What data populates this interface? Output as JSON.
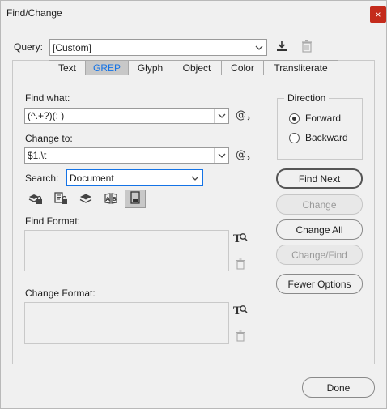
{
  "window": {
    "title": "Find/Change",
    "close_glyph": "×"
  },
  "query": {
    "label": "Query:",
    "value": "[Custom]"
  },
  "tabs": [
    {
      "label": "Text"
    },
    {
      "label": "GREP"
    },
    {
      "label": "Glyph"
    },
    {
      "label": "Object"
    },
    {
      "label": "Color"
    },
    {
      "label": "Transliterate"
    }
  ],
  "find_what": {
    "label": "Find what:",
    "value": "(^.+?)(: )"
  },
  "change_to": {
    "label": "Change to:",
    "value": "$1.\\t"
  },
  "search": {
    "label": "Search:",
    "value": "Document"
  },
  "find_format": {
    "label": "Find Format:"
  },
  "change_format": {
    "label": "Change Format:"
  },
  "direction": {
    "label": "Direction",
    "options": [
      {
        "label": "Forward",
        "selected": true
      },
      {
        "label": "Backward",
        "selected": false
      }
    ]
  },
  "buttons": {
    "find_next": "Find Next",
    "change": "Change",
    "change_all": "Change All",
    "change_find": "Change/Find",
    "fewer_options": "Fewer Options",
    "done": "Done"
  },
  "colors": {
    "accent": "#1473e6",
    "close_bg": "#c42b1c",
    "active_tab_bg": "#c8c8c8"
  }
}
